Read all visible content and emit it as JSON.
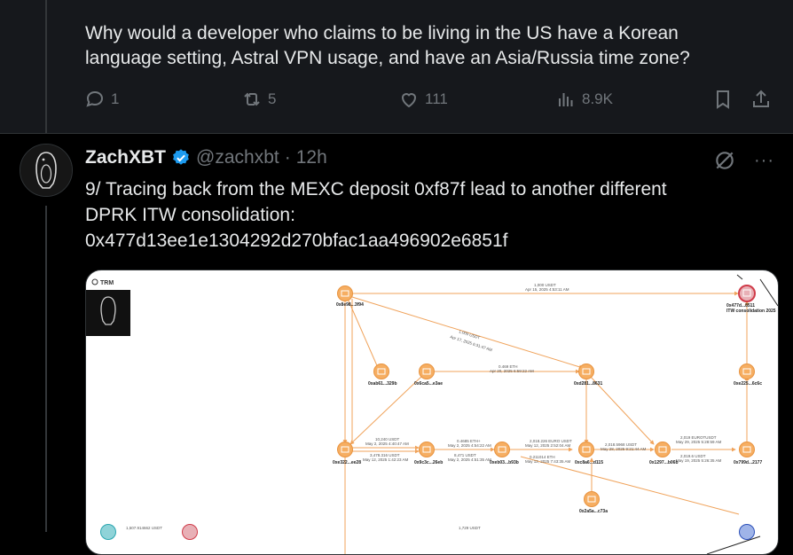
{
  "previous_tweet": {
    "text": "Why would a developer who claims to be living in the US have a Korean language setting, Astral VPN usage, and have an Asia/Russia time zone?",
    "replies": "1",
    "reposts": "5",
    "likes": "111",
    "views": "8.9K"
  },
  "tweet": {
    "name": "ZachXBT",
    "handle": "@zachxbt",
    "separator": "·",
    "time": "12h",
    "more_label": "···",
    "line1": "9/ Tracing back from the MEXC deposit 0xf87f lead to another different",
    "line2": "DPRK ITW consolidation:",
    "line3": "0x477d13ee1e1304292d270bfac1aa496902e6851f"
  },
  "graph": {
    "brand": "TRM",
    "nodes": [
      {
        "label": "0x8e98...3f94"
      },
      {
        "label": "0x477d...8511"
      },
      {
        "label": "ITW consolidation 2025"
      },
      {
        "label": "0xab61...329b"
      },
      {
        "label": "0x6ca5...e3ae"
      },
      {
        "label": "0xd281...8631"
      },
      {
        "label": "0xe225...6c6c"
      },
      {
        "label": "0xe322...ee28"
      },
      {
        "label": "0x9c3c...26eb"
      },
      {
        "label": "0xeb03...b93b"
      },
      {
        "label": "0xc8a6...d115"
      },
      {
        "label": "0x1297...b06b"
      },
      {
        "label": "0x799d...2177"
      },
      {
        "label": "0x2a5a...c73a"
      }
    ],
    "edges": [
      {
        "amount": "1,000 USDT",
        "date": "Apr 15, 2025 4:53:11 AM"
      },
      {
        "amount": "1,000 USDT",
        "date": "Apr 17, 2025 6:31:47 AM"
      },
      {
        "amount": "0.469 ETH",
        "date": "Apr 20, 2025 6:59:22 AM"
      },
      {
        "amount": "10,240 USDT",
        "date": "May 2, 2025 4:40:47 AM"
      },
      {
        "amount": "0.4685 ETH+",
        "date": "May 2, 2025 4:54:22 AM"
      },
      {
        "amount": "2,018.226 EURO USDT",
        "date": "May 12, 2025 2:52:04 AM"
      },
      {
        "amount": "2,018.5968 USDT",
        "date": "May 28, 2025 9:21:44 AM"
      },
      {
        "amount": "2,019 EUROTUSDT",
        "date": "May 29, 2025 5:28:59 AM"
      },
      {
        "amount": "8,471 USDT",
        "date": "May 2, 2025 4:51:35 AM"
      },
      {
        "amount": "0.211014 ETH",
        "date": "May 12, 2025 7:43:35 AM"
      },
      {
        "amount": "3,478.316 USDT",
        "date": "May 12, 2025 1:42:23 AM"
      },
      {
        "amount": "2,019.6 USDT",
        "date": "May 19, 2025 5:26:35 AM"
      },
      {
        "amount": "1,507.914662 USDT",
        "date": ""
      },
      {
        "amount": "1,729 USDT",
        "date": ""
      }
    ]
  }
}
